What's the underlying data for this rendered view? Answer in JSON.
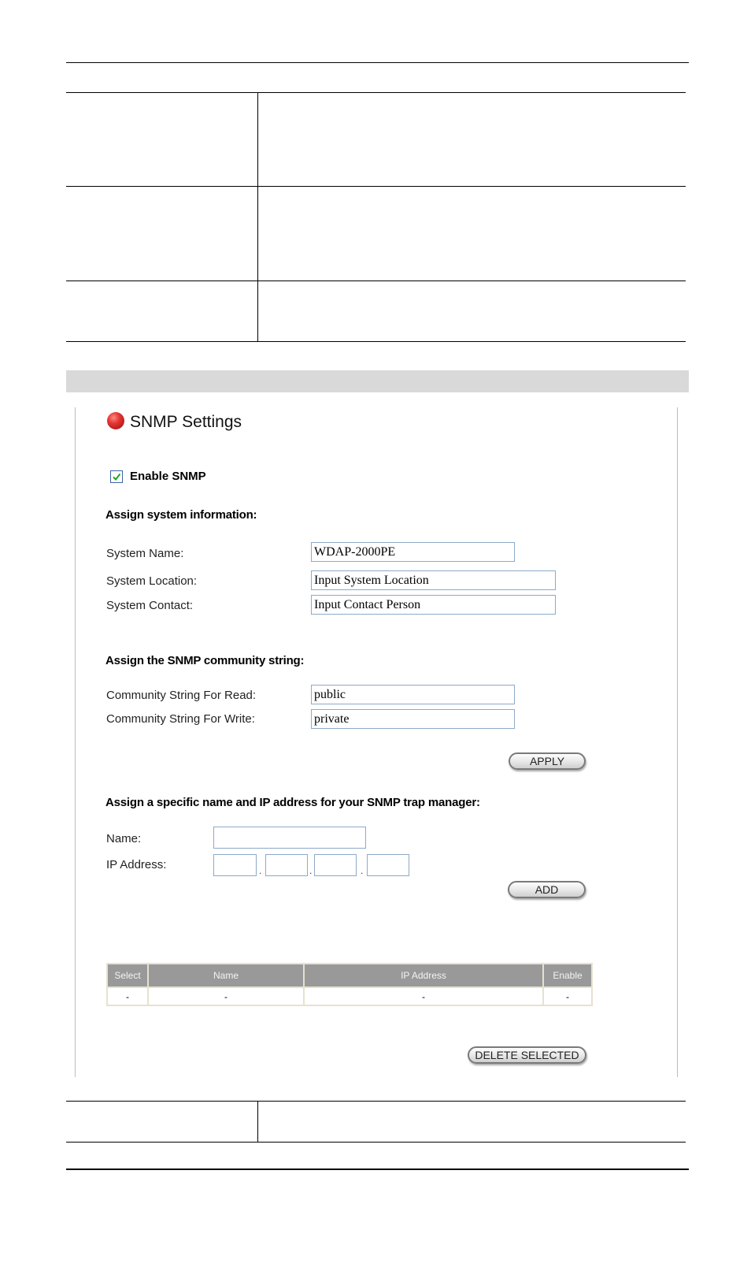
{
  "document": {
    "top_table": {
      "rows": [
        {
          "term": "",
          "description": ""
        },
        {
          "term": "",
          "description": ""
        },
        {
          "term": "",
          "description": ""
        }
      ]
    },
    "bottom_table": {
      "rows": [
        {
          "term": "",
          "description": ""
        }
      ]
    }
  },
  "screen": {
    "title": "SNMP Settings",
    "title_icon": "red-ball-icon",
    "enable_snmp": {
      "label": "Enable SNMP",
      "checked": true
    },
    "system_info": {
      "heading": "Assign system information:",
      "fields": [
        {
          "label": "System Name:",
          "value": "WDAP-2000PE"
        },
        {
          "label": "System Location:",
          "value": "Input System Location"
        },
        {
          "label": "System Contact:",
          "value": "Input Contact Person"
        }
      ]
    },
    "community": {
      "heading": "Assign the SNMP community string:",
      "fields": [
        {
          "label": "Community String For Read:",
          "value": "public"
        },
        {
          "label": "Community String For Write:",
          "value": "private"
        }
      ],
      "apply_label": "APPLY"
    },
    "trap": {
      "heading": "Assign a specific name and IP address for your SNMP trap manager:",
      "name_label": "Name:",
      "name_value": "",
      "ip_label": "IP Address:",
      "ip_octets": [
        "",
        "",
        "",
        ""
      ],
      "ip_separator": ".",
      "add_label": "ADD",
      "table": {
        "columns": [
          "Select",
          "Name",
          "IP Address",
          "Enable"
        ],
        "rows": [
          [
            "-",
            "-",
            "-",
            "-"
          ]
        ]
      },
      "delete_label": "DELETE SELECTED"
    }
  }
}
